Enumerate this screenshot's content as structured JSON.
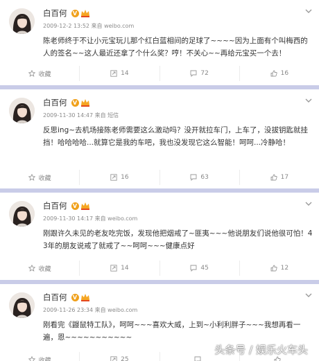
{
  "posts": [
    {
      "name": "白百何",
      "time": "2009-12-2 13:52",
      "source": "来自 weibo.com",
      "text": "陈老师终于不让小元宝玩儿那个红白蓝相间的足球了~~~~因为上面有个叫梅西的人的签名~~这人最近还拿了个什么奖？哼！不关心~~再给元宝买一个去！",
      "fav_label": "收藏",
      "repost": "14",
      "comment": "72",
      "like": "16"
    },
    {
      "name": "白百何",
      "time": "2009-11-30 14:47",
      "source": "来自 短信",
      "text": "反思ing~去机场接陈老师需要这么激动吗？没开就拉车门，上车了，没拔钥匙就挂挡！哈哈哈哈...就算它是我的车吧，我也没发现它这么智能！呵呵...冷静哈！",
      "fav_label": "收藏",
      "repost": "16",
      "comment": "63",
      "like": "17"
    },
    {
      "name": "白百何",
      "time": "2009-11-30 14:17",
      "source": "来自 weibo.com",
      "text": "刚跟许久未见的老友吃完饭，发现他把烟戒了~匪夷~~~他说朋友们说他很可怕！43年的朋友说戒了就戒了~~呵呵~~~健康点好",
      "fav_label": "收藏",
      "repost": "14",
      "comment": "45",
      "like": "12"
    },
    {
      "name": "白百何",
      "time": "2009-11-26 23:34",
      "source": "来自 weibo.com",
      "text": "刚看完《鼹鼠特工队》，呵呵~~~喜欢大威，上到~小利利胖子~~~我想再看一遍，恩~~~~~~~~~~~",
      "fav_label": "收藏",
      "repost": "25",
      "comment": "",
      "like": ""
    }
  ],
  "watermark": "头条号 / 娱乐火车头"
}
